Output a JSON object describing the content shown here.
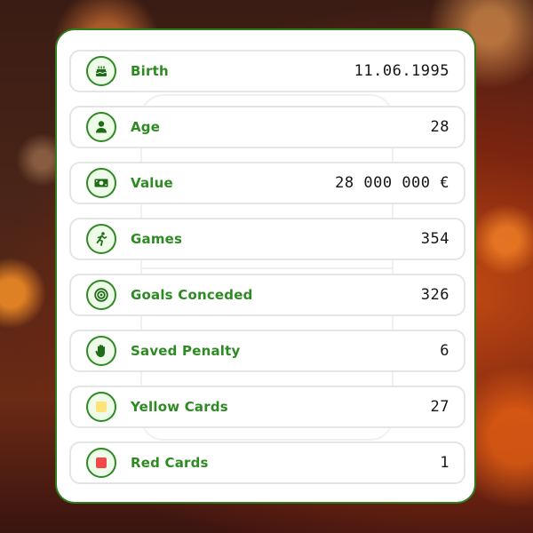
{
  "stats": [
    {
      "label": "Birth",
      "value": "11.06.1995",
      "icon": "cake-icon"
    },
    {
      "label": "Age",
      "value": "28",
      "icon": "person-icon"
    },
    {
      "label": "Value",
      "value": "28 000 000 €",
      "icon": "money-icon"
    },
    {
      "label": "Games",
      "value": "354",
      "icon": "running-player-icon"
    },
    {
      "label": "Goals Conceded",
      "value": "326",
      "icon": "target-icon"
    },
    {
      "label": "Saved Penalty",
      "value": "6",
      "icon": "hand-icon"
    },
    {
      "label": "Yellow Cards",
      "value": "27",
      "icon": "yellow-card-icon"
    },
    {
      "label": "Red Cards",
      "value": "1",
      "icon": "red-card-icon"
    }
  ],
  "colors": {
    "accent": "#2e8a22",
    "border": "#2e7d1d",
    "yellow_card": "#ffe27a",
    "red_card": "#f24a4a"
  }
}
